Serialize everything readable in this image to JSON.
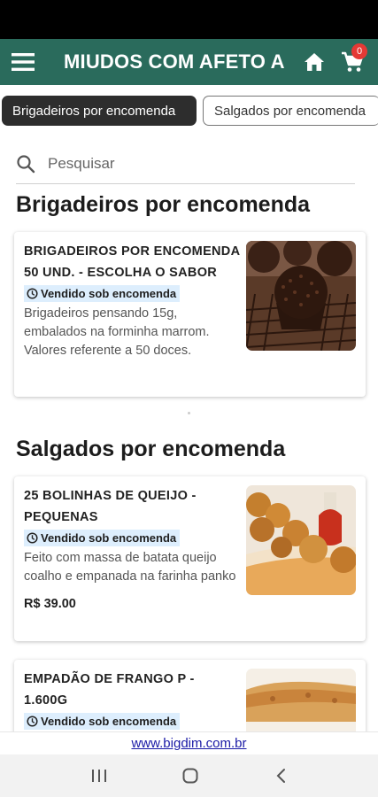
{
  "app_bar": {
    "title": "MIUDOS COM AFETO A",
    "cart_count": "0",
    "colors": {
      "background": "#2a6b5c",
      "badge": "#e53935"
    }
  },
  "tabs": [
    {
      "label": "Brigadeiros por encomenda",
      "active": true
    },
    {
      "label": "Salgados por encomenda",
      "active": false
    }
  ],
  "search": {
    "placeholder": "Pesquisar",
    "value": ""
  },
  "sections": [
    {
      "title": "Brigadeiros por encomenda",
      "products": [
        {
          "name": "BRIGADEIROS POR ENCOMENDA 50 UND. - ESCOLHA O SABOR",
          "badge": "Vendido sob encomenda",
          "description": "Brigadeiros pensando 15g, embalados na forminha marrom. Valores referente a 50 doces.",
          "price": ""
        }
      ]
    },
    {
      "title": "Salgados por encomenda",
      "products": [
        {
          "name": "25 BOLINHAS DE QUEIJO - PEQUENAS",
          "badge": "Vendido sob encomenda",
          "description": "Feito com massa de batata queijo coalho e empanada na farinha panko",
          "price": "R$ 39.00"
        },
        {
          "name": "EMPADÃO DE FRANGO P - 1.600G",
          "badge": "Vendido sob encomenda",
          "description": "",
          "price": ""
        }
      ]
    }
  ],
  "footer": {
    "link": "www.bigdim.com.br"
  },
  "icons": [
    "menu-icon",
    "home-icon",
    "cart-icon",
    "search-icon",
    "clock-icon",
    "recent-apps-icon",
    "home-circle-icon",
    "back-icon"
  ]
}
